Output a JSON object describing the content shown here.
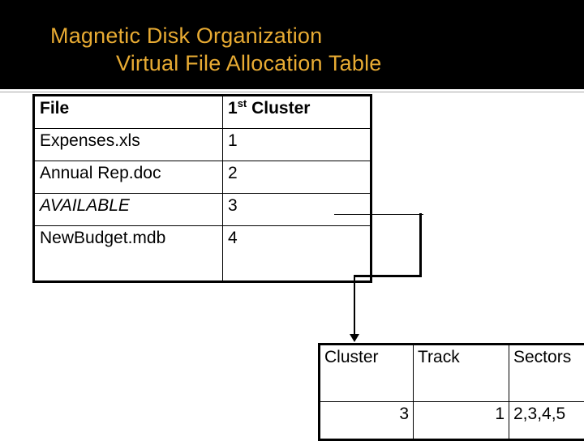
{
  "title": {
    "line1": "Magnetic Disk Organization",
    "line2": "Virtual File Allocation Table",
    "color": "#e8ab33",
    "background": "#000000"
  },
  "fat_table": {
    "name": "virtual-file-allocation-table",
    "headers": {
      "file": "File",
      "cluster_prefix": "1",
      "cluster_superscript": "st",
      "cluster_suffix": " Cluster"
    },
    "rows": [
      {
        "file": "Expenses.xls",
        "cluster": "1",
        "italic": false
      },
      {
        "file": "Annual Rep.doc",
        "cluster": "2",
        "italic": false
      },
      {
        "file": "AVAILABLE",
        "cluster": "3",
        "italic": true
      },
      {
        "file": "NewBudget.mdb",
        "cluster": "4",
        "italic": false
      }
    ]
  },
  "cluster_table": {
    "name": "cluster-location-table",
    "headers": {
      "cluster": "Cluster",
      "track": "Track",
      "sectors": "Sectors"
    },
    "row": {
      "cluster": "3",
      "track": "1",
      "sectors": "2,3,4,5"
    }
  },
  "connector": {
    "description": "arrow-from-available-row-to-cluster-table",
    "color": "#000000"
  }
}
